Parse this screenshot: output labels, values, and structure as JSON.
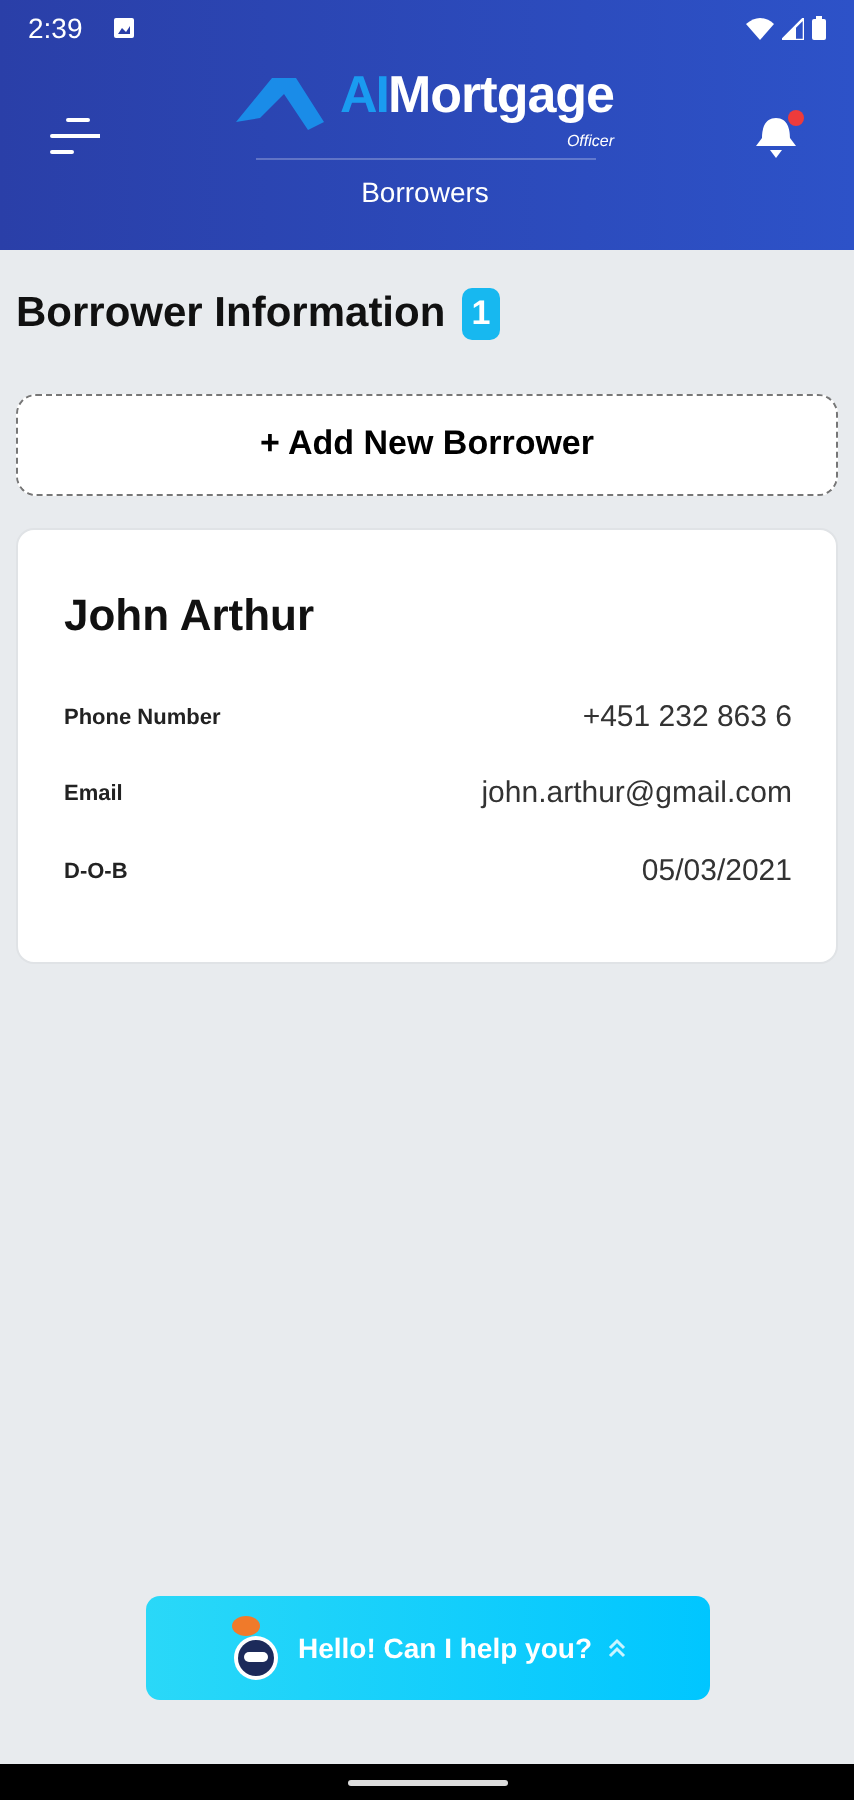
{
  "status_bar": {
    "time": "2:39"
  },
  "header": {
    "logo_prefix": "AI",
    "logo_name": "Mortgage",
    "logo_sub": "Officer",
    "title": "Borrowers",
    "notification_unread": true
  },
  "section": {
    "title": "Borrower Information",
    "count": "1"
  },
  "add_button": {
    "label": "+ Add New Borrower"
  },
  "borrowers": [
    {
      "name": "John Arthur",
      "fields": [
        {
          "label": "Phone Number",
          "value": "+451 232 863 6"
        },
        {
          "label": "Email",
          "value": "john.arthur@gmail.com"
        },
        {
          "label": "D-O-B",
          "value": "05/03/2021"
        }
      ]
    }
  ],
  "chat_button": {
    "label": "Hello! Can I help you?"
  }
}
